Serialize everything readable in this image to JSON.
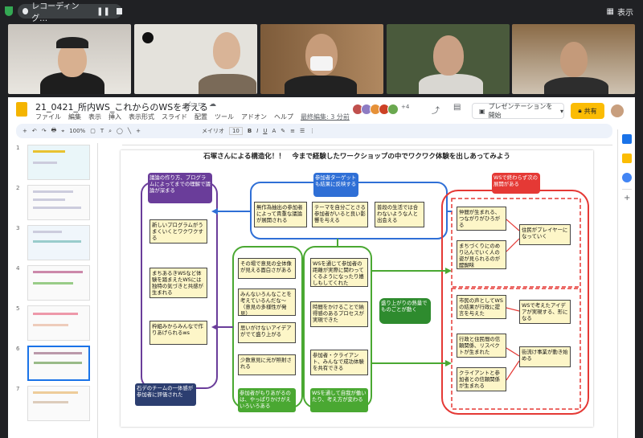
{
  "recording": {
    "label": "レコーディング…",
    "view_label": "表示"
  },
  "doc": {
    "title": "21_0421_所内WS_これからのWSを考える",
    "last_edit": "最終編集: 3 分前",
    "present_label": "プレゼンテーションを開始",
    "share_label": "共有",
    "avatars_more": "+4"
  },
  "menus": [
    "ファイル",
    "編集",
    "表示",
    "挿入",
    "表示形式",
    "スライド",
    "配置",
    "ツール",
    "アドオン",
    "ヘルプ"
  ],
  "toolbar": {
    "font": "メイリオ",
    "size": "10",
    "items": [
      "+",
      "↶",
      "↷",
      "🖶",
      "⌖",
      "100%",
      "▢",
      "T",
      "⌕",
      "◯",
      "╲",
      "+",
      "B",
      "I",
      "U",
      "A",
      "✎",
      "≡",
      "☰",
      "⋮"
    ]
  },
  "slide_numbers": [
    "1",
    "2",
    "3",
    "4",
    "5",
    "6",
    "7"
  ],
  "slide": {
    "title": "石塚さんによる構造化！！　今まで経験したワークショップの中でワクワク体験を出しあってみよう",
    "left_header": "議論の作り方、プログラムによってまでの理解で議論が深まる",
    "left_items": [
      "新しいプログラムがうまくいくとワクワクする",
      "まちあるきWSなど体験を踏まえたWSには独特の気づきと共感が生まれる",
      "枠組みからみんなで作りあげられるws"
    ],
    "left_bottom": "石デのチームの一体感が参加者に評価された",
    "top_header": "参加者ターゲットも結果に反映する",
    "top_items": [
      "無作為抽出の参加者によって貴重な議論が展開される",
      "テーマを自分ごとさる参加者がいると良い影響を与える",
      "普段の生活では合わないような人と出会える"
    ],
    "col2_items": [
      "その場で意見の全体像が見える面白さがある",
      "みんないろんなことを考えているんだな～（意見の多様性が発見）",
      "思いがけないアイデアがでて盛り上がる",
      "少数意見に光が照射される"
    ],
    "col2_bottom": "参加者がもりあがるのは、やっぱりかけがえいろいろある",
    "col3_items": [
      "WSを通じて参加者の距離が実際に関わってくるようになったり嬉しもしてくれた",
      "時間をかけることで納得感のあるプロセスが実現できた",
      "参加者・クライアント、みんなで成功体験を共有できる"
    ],
    "col3_bottom": "WSを通して自我が働いたり、考え方が変わる",
    "center_label": "盛り上がりの熱量でものごとが動く",
    "right_header": "WSで終わらず次の展開がある",
    "right_top": [
      "仲間が生まれる、つながりがひろがる",
      "まちづくりにのめり込んでいく人の姿が見られるのが醍醐味"
    ],
    "right_top_out": "住民がプレイヤーになっていく",
    "right_bottom": [
      "市民の声としてWSの結果が行政に提言を与えた",
      "行政と住民間の信頼関係、リスペクトが生まれた",
      "クライアントと参加者との信頼関係が生まれる"
    ],
    "right_out1": "WSで考えたアイデアが実現する、形になる",
    "right_out2": "街流け事業が動き始める"
  },
  "colors": {
    "purple": "#6a3d9a",
    "blue": "#2f6fd6",
    "green": "#4aa832",
    "red": "#e53935",
    "yellow_box": "#fdf6c8"
  }
}
